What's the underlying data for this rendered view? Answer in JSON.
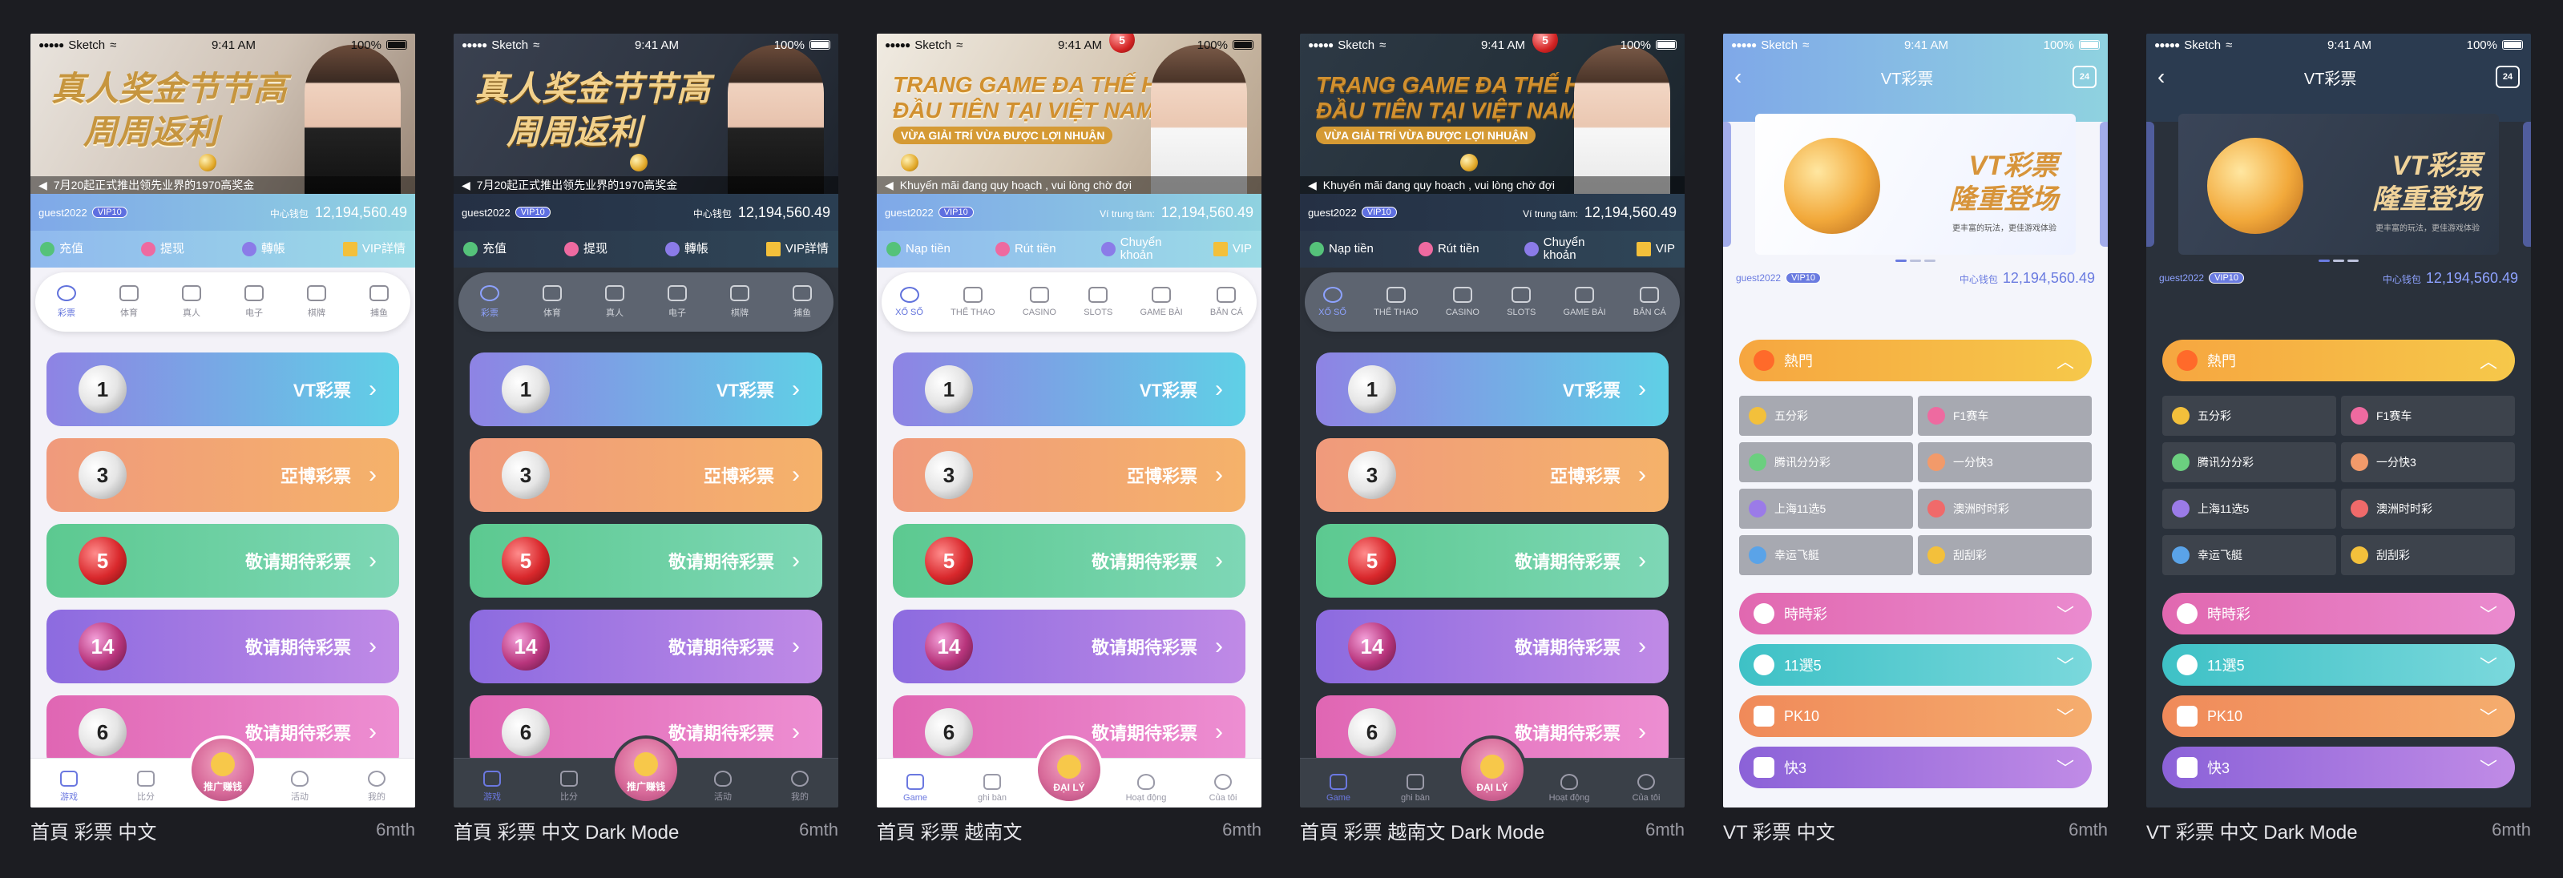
{
  "common": {
    "carrier": "Sketch",
    "time": "9:41 AM",
    "battery": "100%",
    "username": "guest2022",
    "vip": "VIP10",
    "balance": "12,194,560.49"
  },
  "zh": {
    "banner_line1": "真人奖金节节高",
    "banner_line2": "周周返利",
    "marquee": "7月20起正式推出领先业界的1970高奖金",
    "wallet_label": "中心钱包",
    "act1": "充值",
    "act2": "提现",
    "act3": "轉帳",
    "act4": "VIP詳情",
    "cat1": "彩票",
    "cat2": "体育",
    "cat3": "真人",
    "cat4": "电子",
    "cat5": "棋牌",
    "cat6": "捕鱼",
    "lot1": "VT彩票",
    "lot2": "亞博彩票",
    "lot3": "敬请期待彩票",
    "tab1": "游戏",
    "tab2": "比分",
    "tab3": "推广赚钱",
    "tab4": "活动",
    "tab5": "我的"
  },
  "vi": {
    "banner_line1": "TRANG GAME ĐA THẾ HỆ",
    "banner_line2": "ĐẦU TIÊN TẠI VIỆT NAM",
    "banner_sub": "VỪA GIẢI TRÍ VỪA ĐƯỢC LỢI NHUẬN",
    "marquee": "Khuyến mãi đang quy hoạch , vui lòng chờ đợi",
    "wallet_label": "Ví trung tâm:",
    "act1": "Nạp tiền",
    "act2": "Rút tiền",
    "act3": "Chuyển khoản",
    "act4": "VIP",
    "cat1": "XỔ SỐ",
    "cat2": "THỂ THAO",
    "cat3": "CASINO",
    "cat4": "SLOTS",
    "cat5": "GAME BÀI",
    "cat6": "BẮN CÁ",
    "tab1": "Game",
    "tab2": "ghi bàn",
    "tab3": "ĐẠI LÝ",
    "tab4": "Hoạt động",
    "tab5": "Của tôi"
  },
  "vt": {
    "title": "VT彩票",
    "banner_line1": "VT彩票",
    "banner_line2": "隆重登场",
    "banner_sub": "更丰富的玩法，更佳游戏体验",
    "hot": "熱門",
    "games": [
      "五分彩",
      "F1赛车",
      "腾讯分分彩",
      "一分快3",
      "上海11选5",
      "澳洲时时彩",
      "幸运飞艇",
      "刮刮彩"
    ],
    "sec1": "時時彩",
    "sec2": "11選5",
    "sec3": "PK10",
    "sec4": "快3"
  },
  "captions": [
    {
      "title": "首頁 彩票 中文",
      "age": "6mth"
    },
    {
      "title": "首頁 彩票 中文 Dark Mode",
      "age": "6mth"
    },
    {
      "title": "首頁 彩票 越南文",
      "age": "6mth"
    },
    {
      "title": "首頁 彩票 越南文 Dark Mode",
      "age": "6mth"
    },
    {
      "title": "VT 彩票 中文",
      "age": "6mth"
    },
    {
      "title": "VT 彩票 中文 Dark Mode",
      "age": "6mth"
    }
  ],
  "colors": {
    "canvas_bg": "#1c1d22",
    "accent": "#6a7be0",
    "hot": "#f6b443",
    "timed": "#e168b0",
    "eleven": "#3ec1c6",
    "pk10": "#f08a5a",
    "k3": "#8b62d8"
  }
}
